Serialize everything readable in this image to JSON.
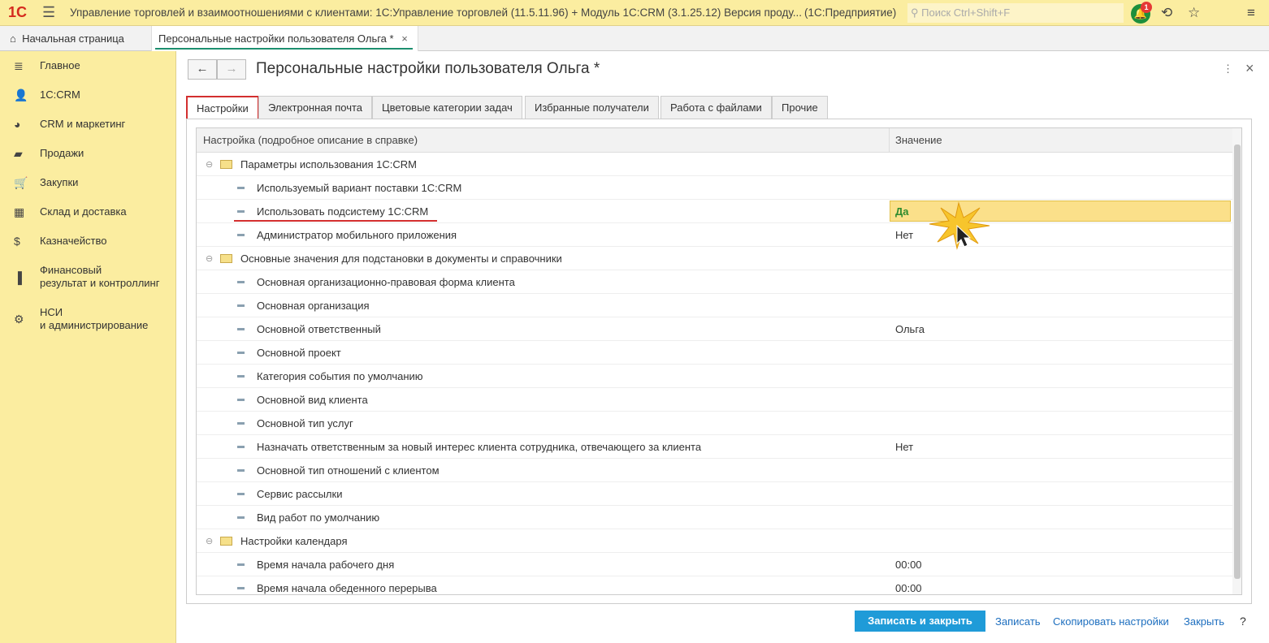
{
  "app": {
    "logo": "1С",
    "title": "Управление торговлей и взаимоотношениями с клиентами: 1С:Управление торговлей (11.5.11.96) + Модуль 1С:CRM (3.1.25.12) Версия проду...",
    "platform": "(1С:Предприятие)",
    "search_placeholder": "Поиск Ctrl+Shift+F",
    "notifications": "1"
  },
  "open_tabs": [
    {
      "label": "Начальная страница"
    },
    {
      "label": "Персональные настройки пользователя Ольга *"
    }
  ],
  "sidebar": {
    "items": [
      {
        "label": "Главное"
      },
      {
        "label": "1С:CRM"
      },
      {
        "label": "CRM и маркетинг"
      },
      {
        "label": "Продажи"
      },
      {
        "label": "Закупки"
      },
      {
        "label": "Склад и доставка"
      },
      {
        "label": "Казначейство"
      },
      {
        "label": "Финансовый",
        "label2": "результат и контроллинг"
      },
      {
        "label": "НСИ",
        "label2": "и администрирование"
      }
    ]
  },
  "form": {
    "title": "Персональные настройки пользователя Ольга *",
    "tabs": [
      "Настройки",
      "Электронная почта",
      "Цветовые категории задач",
      "Избранные получатели",
      "Работа с файлами",
      "Прочие"
    ],
    "columns": [
      "Настройка (подробное описание в справке)",
      "Значение"
    ],
    "rows": [
      {
        "type": "group",
        "label": "Параметры использования 1С:CRM",
        "value": ""
      },
      {
        "type": "item",
        "label": "Используемый вариант поставки 1С:CRM",
        "value": ""
      },
      {
        "type": "item",
        "label": "Использовать подсистему 1С:CRM",
        "value": "Да"
      },
      {
        "type": "item",
        "label": "Администратор мобильного приложения",
        "value": "Нет"
      },
      {
        "type": "group",
        "label": "Основные значения для подстановки в документы и справочники",
        "value": ""
      },
      {
        "type": "item",
        "label": "Основная организационно-правовая форма клиента",
        "value": ""
      },
      {
        "type": "item",
        "label": "Основная организация",
        "value": ""
      },
      {
        "type": "item",
        "label": "Основной ответственный",
        "value": "Ольга"
      },
      {
        "type": "item",
        "label": "Основной проект",
        "value": ""
      },
      {
        "type": "item",
        "label": "Категория события по умолчанию",
        "value": ""
      },
      {
        "type": "item",
        "label": "Основной вид клиента",
        "value": ""
      },
      {
        "type": "item",
        "label": "Основной тип услуг",
        "value": ""
      },
      {
        "type": "item",
        "label": "Назначать ответственным за новый интерес клиента сотрудника, отвечающего за клиента",
        "value": "Нет"
      },
      {
        "type": "item",
        "label": "Основной тип отношений с клиентом",
        "value": ""
      },
      {
        "type": "item",
        "label": "Сервис рассылки",
        "value": ""
      },
      {
        "type": "item",
        "label": "Вид работ по умолчанию",
        "value": ""
      },
      {
        "type": "group",
        "label": "Настройки календаря",
        "value": ""
      },
      {
        "type": "item",
        "label": "Время начала рабочего дня",
        "value": "00:00"
      },
      {
        "type": "item",
        "label": "Время начала обеденного перерыва",
        "value": "00:00"
      }
    ]
  },
  "footer": {
    "save_close": "Записать и закрыть",
    "save": "Записать",
    "copy": "Скопировать настройки",
    "close": "Закрыть",
    "help": "?"
  }
}
